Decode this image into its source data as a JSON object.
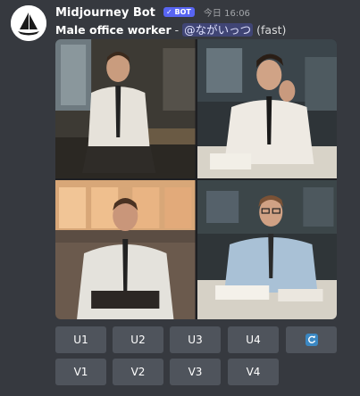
{
  "message": {
    "author": "Midjourney Bot",
    "badge": "✓ BOT",
    "timestamp": "今日 16:06",
    "prompt": "Male office worker",
    "separator": " - ",
    "mention": "@ながいっつ",
    "mode": " (fast)"
  },
  "image": {
    "tiles": [
      {
        "label": "office worker portrait 1"
      },
      {
        "label": "office worker portrait 2"
      },
      {
        "label": "office worker portrait 3"
      },
      {
        "label": "office worker portrait 4"
      }
    ]
  },
  "buttons": {
    "upscale": [
      "U1",
      "U2",
      "U3",
      "U4"
    ],
    "variation": [
      "V1",
      "V2",
      "V3",
      "V4"
    ],
    "reroll_icon": "refresh-icon"
  },
  "colors": {
    "background": "#36393f",
    "button": "#4f545c",
    "bot_badge": "#5865f2",
    "reroll_blue": "#3b88c3"
  }
}
